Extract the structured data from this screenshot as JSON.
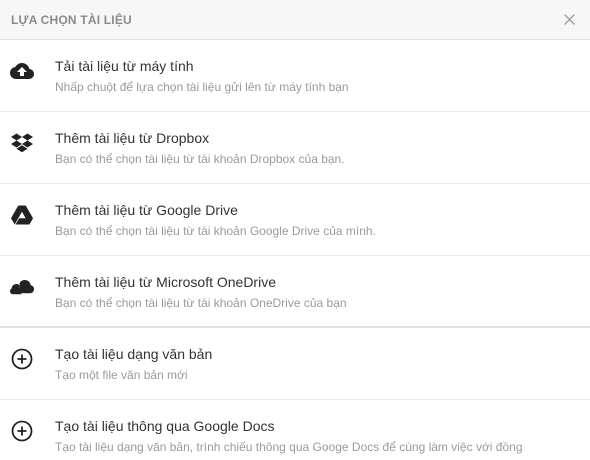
{
  "dialog": {
    "title": "LỰA CHỌN TÀI LIỆU",
    "close_icon": "close-icon"
  },
  "options": [
    {
      "icon": "cloud-upload-icon",
      "title": "Tải tài liệu từ máy tính",
      "description": "Nhấp chuột để lựa chọn tài liệu gửi lên từ máy tính bạn"
    },
    {
      "icon": "dropbox-icon",
      "title": "Thêm tài liệu từ Dropbox",
      "description": "Bạn có thể chọn tài liệu từ tài khoản Dropbox của bạn."
    },
    {
      "icon": "google-drive-icon",
      "title": "Thêm tài liệu từ Google Drive",
      "description": "Bạn có thể chọn tài liệu từ tài khoản Google Drive của mình."
    },
    {
      "icon": "onedrive-icon",
      "title": "Thêm tài liệu từ Microsoft OneDrive",
      "description": "Bạn có thể chọn tài liệu từ tài khoản OneDrive của bạn"
    },
    {
      "icon": "plus-circle-icon",
      "title": "Tạo tài liệu dạng văn bản",
      "description": "Tạo một file văn bản mới"
    },
    {
      "icon": "plus-circle-icon",
      "title": "Tạo tài liệu thông qua Google Docs",
      "description": "Tạo tài liệu dạng văn bản, trình chiếu thông qua Googe Docs để cùng làm việc với đồng"
    }
  ]
}
